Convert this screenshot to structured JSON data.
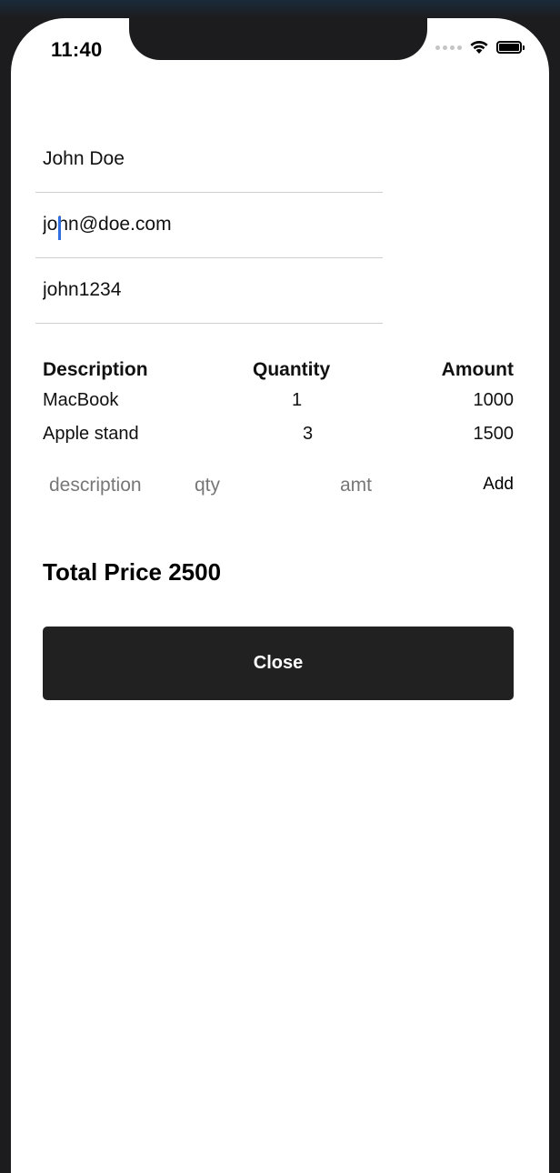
{
  "status_bar": {
    "time": "11:40"
  },
  "form": {
    "name_value": "John Doe",
    "email_value": "john@doe.com",
    "password_value": "john1234"
  },
  "table": {
    "headers": {
      "description": "Description",
      "quantity": "Quantity",
      "amount": "Amount"
    },
    "rows": [
      {
        "description": "MacBook",
        "quantity": "1",
        "amount": "1000"
      },
      {
        "description": "Apple stand",
        "quantity": "3",
        "amount": "1500"
      }
    ]
  },
  "add_item": {
    "description_placeholder": "description",
    "qty_placeholder": "qty",
    "amt_placeholder": "amt",
    "add_label": "Add"
  },
  "total": {
    "label": "Total Price 2500"
  },
  "actions": {
    "close_label": "Close"
  },
  "icons": {
    "wifi": "wifi-icon",
    "battery": "battery-icon",
    "cellular": "cellular-signal-icon"
  }
}
